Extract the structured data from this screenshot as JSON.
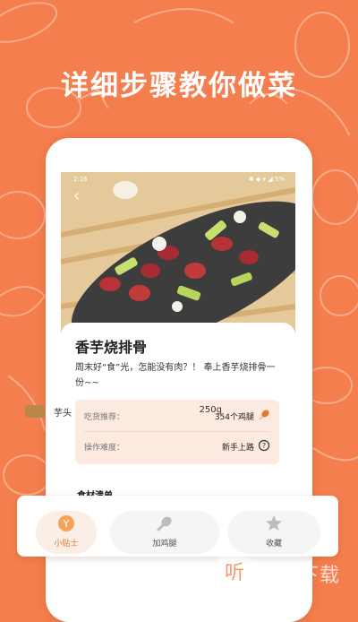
{
  "banner": {
    "headline": "详细步骤教你做菜"
  },
  "status_bar": {
    "time": "2:16",
    "battery": "5%"
  },
  "recipe": {
    "title": "香芋烧排骨",
    "description": "周末好“食”光，怎能没有肉？！ 奉上香芋烧排骨一份~~",
    "info": [
      {
        "label": "吃货推荐：",
        "value": "354个鸡腿",
        "icon": "drumstick-icon"
      },
      {
        "label": "操作难度：",
        "value": "新手上路",
        "icon": "question-circle-icon"
      }
    ],
    "ingredients_header": "食材清单",
    "ingredient_row": {
      "name": "芋头",
      "amount": "250g"
    }
  },
  "bottom_bar": {
    "tips_label": "小贴士",
    "chicken_label": "加鸡腿",
    "favorite_label": "收藏"
  },
  "watermark": {
    "text": "一听下载"
  },
  "colors": {
    "background": "#f57e4e",
    "accent": "#e0742f",
    "info_box": "#fce9df"
  }
}
